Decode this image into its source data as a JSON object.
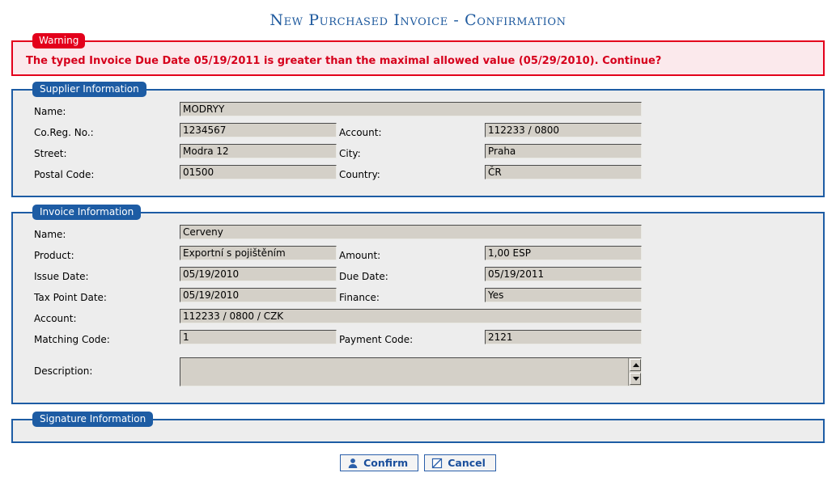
{
  "page": {
    "title": "New Purchased Invoice - Confirmation"
  },
  "warning": {
    "legend": "Warning",
    "message": "The typed Invoice Due Date 05/19/2011 is greater than the maximal allowed value (05/29/2010). Continue?",
    "accent_color": "#e3001b",
    "background_color": "#fbe9ec"
  },
  "supplier": {
    "legend": "Supplier Information",
    "fields": {
      "name_label": "Name:",
      "name_value": "MODRYY",
      "coreg_label": "Co.Reg. No.:",
      "coreg_value": "1234567",
      "account_label": "Account:",
      "account_value": "112233 / 0800",
      "street_label": "Street:",
      "street_value": "Modra 12",
      "city_label": "City:",
      "city_value": "Praha",
      "postal_label": "Postal Code:",
      "postal_value": "01500",
      "country_label": "Country:",
      "country_value": "ČR"
    }
  },
  "invoice": {
    "legend": "Invoice Information",
    "fields": {
      "name_label": "Name:",
      "name_value": "Cerveny",
      "product_label": "Product:",
      "product_value": "Exportní s pojištěním",
      "amount_label": "Amount:",
      "amount_value": "1,00 ESP",
      "issue_date_label": "Issue Date:",
      "issue_date_value": "05/19/2010",
      "due_date_label": "Due Date:",
      "due_date_value": "05/19/2011",
      "tax_point_label": "Tax Point Date:",
      "tax_point_value": "05/19/2010",
      "finance_label": "Finance:",
      "finance_value": "Yes",
      "account_label": "Account:",
      "account_value": "112233 / 0800 / CZK",
      "matching_code_label": "Matching Code:",
      "matching_code_value": "1",
      "payment_code_label": "Payment Code:",
      "payment_code_value": "2121",
      "description_label": "Description:",
      "description_value": ""
    }
  },
  "signature": {
    "legend": "Signature Information"
  },
  "actions": {
    "confirm_label": "Confirm",
    "confirm_icon": "user-icon",
    "cancel_label": "Cancel",
    "cancel_icon": "cancel-slash-icon",
    "text_color": "#1b4f9c"
  },
  "theme": {
    "legend_blue": "#1d5ca4",
    "fieldset_fill": "#ededed",
    "field_fill": "#d4d0c8",
    "title_color": "#1f5a9e"
  }
}
